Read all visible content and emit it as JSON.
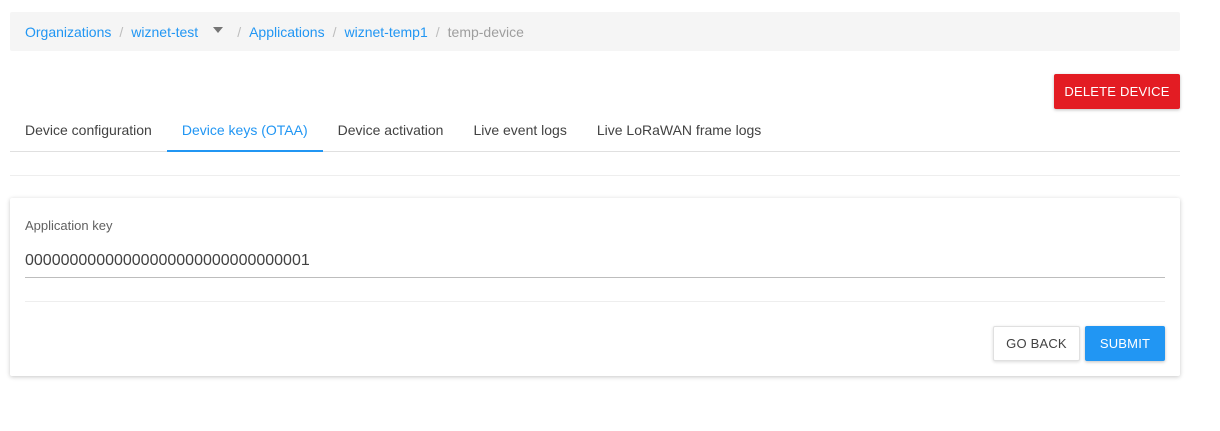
{
  "breadcrumb": {
    "organizations": "Organizations",
    "organization": "wiznet-test",
    "applications": "Applications",
    "application": "wiznet-temp1",
    "device": "temp-device",
    "separator": "/"
  },
  "header": {
    "delete_label": "DELETE DEVICE"
  },
  "tabs": [
    {
      "label": "Device configuration",
      "active": false
    },
    {
      "label": "Device keys (OTAA)",
      "active": true
    },
    {
      "label": "Device activation",
      "active": false
    },
    {
      "label": "Live event logs",
      "active": false
    },
    {
      "label": "Live LoRaWAN frame logs",
      "active": false
    }
  ],
  "form": {
    "app_key_label": "Application key",
    "app_key_value": "00000000000000000000000000000001",
    "go_back_label": "GO BACK",
    "submit_label": "SUBMIT"
  },
  "colors": {
    "accent": "#2196f3",
    "danger": "#e31c23",
    "breadcrumb_bg": "#f5f5f5"
  },
  "icons": {
    "organization_dropdown": "chevron-down-icon"
  }
}
